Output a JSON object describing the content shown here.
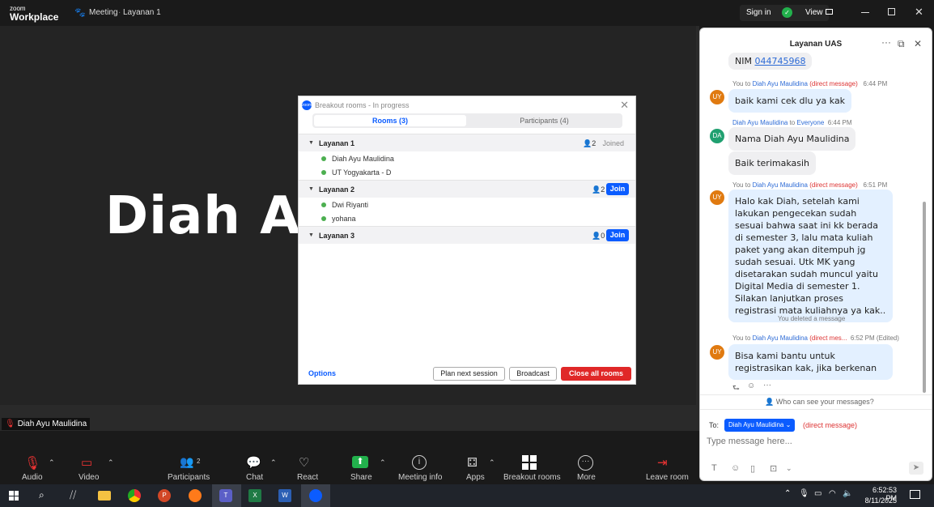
{
  "titlebar": {
    "brand_line1": "zoom",
    "brand_line2": "Workplace",
    "meeting_label": "Meeting",
    "meeting_separator": "·",
    "meeting_room": "Layanan 1",
    "sign_in": "Sign in",
    "view": "View",
    "minimize_icon": "minimize-icon",
    "restore_icon": "restore-icon",
    "close_icon": "close-icon"
  },
  "video": {
    "big_name": "Diah Ay",
    "name_tag": "Diah Ayu Maulidina"
  },
  "toolbar": {
    "audio": "Audio",
    "video": "Video",
    "participants": "Participants",
    "participants_count": "2",
    "chat": "Chat",
    "react": "React",
    "share": "Share",
    "meeting_info": "Meeting info",
    "apps": "Apps",
    "breakout_rooms": "Breakout rooms",
    "more": "More",
    "leave_room": "Leave room"
  },
  "breakout": {
    "title": "Breakout rooms - In progress",
    "logo_text": "zoom",
    "tab_rooms": "Rooms (3)",
    "tab_participants": "Participants (4)",
    "rooms": [
      {
        "name": "Layanan 1",
        "count": "2",
        "status": "Joined",
        "members": [
          "Diah Ayu Maulidina",
          "UT Yogyakarta - D"
        ]
      },
      {
        "name": "Layanan 2",
        "count": "2",
        "action": "Join",
        "members": [
          "Dwi Riyanti",
          "yohana"
        ]
      },
      {
        "name": "Layanan 3",
        "count": "0",
        "action": "Join",
        "members": []
      }
    ],
    "options": "Options",
    "plan_next": "Plan next session",
    "broadcast": "Broadcast",
    "close_all": "Close all rooms"
  },
  "chat": {
    "title": "Layanan UAS",
    "messages": {
      "m0_text": "NIM ",
      "m0_link": "044745968",
      "m1_from": "You to ",
      "m1_to": "Diah Ayu Maulidina",
      "m1_dm": "(direct message)",
      "m1_time": "6:44 PM",
      "m1_text": "baik kami cek dlu ya kak",
      "m2_from": "Diah Ayu Maulidina",
      "m2_to_word": " to ",
      "m2_to": "Everyone",
      "m2_time": "6:44 PM",
      "m2_text": "Nama Diah Ayu Maulidina",
      "m3_text": "Baik terimakasih",
      "m4_from": "You to ",
      "m4_to": "Diah Ayu Maulidina",
      "m4_dm": "(direct message)",
      "m4_time": "6:51 PM",
      "m4_text": "Halo kak Diah, setelah kami lakukan pengecekan sudah sesuai bahwa saat ini kk berada di semester 3, lalu mata kuliah paket yang akan ditempuh jg sudah sesuai. Utk MK yang disetarakan sudah muncul yaitu Digital Media di semester 1. Silakan lanjutkan proses registrasi mata kuliahnya ya kak..",
      "deleted": "You deleted a message",
      "m5_from": "You to ",
      "m5_to": "Diah Ayu Maulidina",
      "m5_dm": "(direct mes...",
      "m5_time": "6:52 PM (Edited)",
      "m5_text": "Bisa kami bantu untuk registrasikan kak, jika berkenan"
    },
    "avatar_you": "UY",
    "avatar_diah": "DA",
    "who_can_see": "Who can see your messages?",
    "to_label": "To:",
    "to_recipient": "Diah Ayu Maulidina ⌄",
    "to_dm": "(direct message)",
    "input_placeholder": "Type message here..."
  },
  "taskbar": {
    "time": "6:52:53 PM",
    "date": "8/11/2025"
  },
  "colors": {
    "accent": "#0b5cff",
    "danger": "#e02828",
    "dm_red": "#d33333",
    "name_blue": "#2d6bd6",
    "bubble_blue": "#e3f0ff"
  }
}
